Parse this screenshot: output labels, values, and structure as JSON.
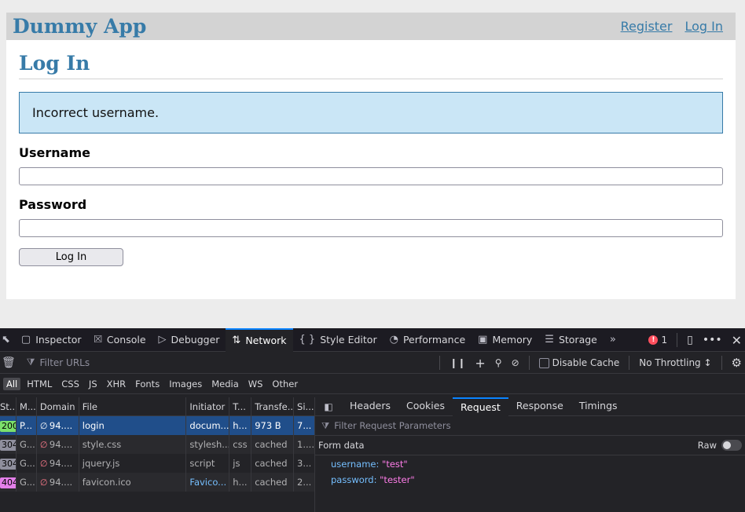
{
  "app": {
    "title": "Dummy App",
    "nav": {
      "register": "Register",
      "login": "Log In"
    }
  },
  "page": {
    "title": "Log In",
    "flash": "Incorrect username.",
    "username_label": "Username",
    "username_value": "",
    "password_label": "Password",
    "password_value": "",
    "submit_label": "Log In"
  },
  "devtools": {
    "tabs": [
      {
        "label": "Inspector",
        "icon": "inspector-icon"
      },
      {
        "label": "Console",
        "icon": "console-icon"
      },
      {
        "label": "Debugger",
        "icon": "debugger-icon"
      },
      {
        "label": "Network",
        "icon": "network-icon",
        "active": true
      },
      {
        "label": "Style Editor",
        "icon": "braces-icon"
      },
      {
        "label": "Performance",
        "icon": "gauge-icon"
      },
      {
        "label": "Memory",
        "icon": "chip-icon"
      },
      {
        "label": "Storage",
        "icon": "storage-icon"
      }
    ],
    "error_count": "1",
    "toolbar": {
      "filter_placeholder": "Filter URLs",
      "disable_cache_label": "Disable Cache",
      "throttling_label": "No Throttling ↕"
    },
    "type_filters": [
      "All",
      "HTML",
      "CSS",
      "JS",
      "XHR",
      "Fonts",
      "Images",
      "Media",
      "WS",
      "Other"
    ],
    "columns": [
      "St...",
      "M...",
      "Domain",
      "File",
      "Initiator",
      "T...",
      "Transfe...",
      "Si..."
    ],
    "requests": [
      {
        "status": "200",
        "method": "P...",
        "domain": "94....",
        "file": "login",
        "initiator": "docum...",
        "type": "h...",
        "transferred": "973 B",
        "size": "7..."
      },
      {
        "status": "304",
        "method": "G...",
        "domain": "94....",
        "file": "style.css",
        "initiator": "stylesh...",
        "type": "css",
        "transferred": "cached",
        "size": "1...."
      },
      {
        "status": "304",
        "method": "G...",
        "domain": "94....",
        "file": "jquery.js",
        "initiator": "script",
        "type": "js",
        "transferred": "cached",
        "size": "3..."
      },
      {
        "status": "404",
        "method": "G...",
        "domain": "94....",
        "file": "favicon.ico",
        "initiator": "Favico...",
        "type": "h...",
        "transferred": "cached",
        "size": "2..."
      }
    ],
    "status_colors": {
      "200": "#7ce06b",
      "304": "#8f8f9d",
      "404": "#e37fe9"
    },
    "detail_tabs": [
      "Headers",
      "Cookies",
      "Request",
      "Response",
      "Timings"
    ],
    "detail_active": "Request",
    "request_filter_placeholder": "Filter Request Parameters",
    "form_data_label": "Form data",
    "raw_label": "Raw",
    "params": [
      {
        "key": "username:",
        "value": "\"test\""
      },
      {
        "key": "password:",
        "value": "\"tester\""
      }
    ]
  }
}
